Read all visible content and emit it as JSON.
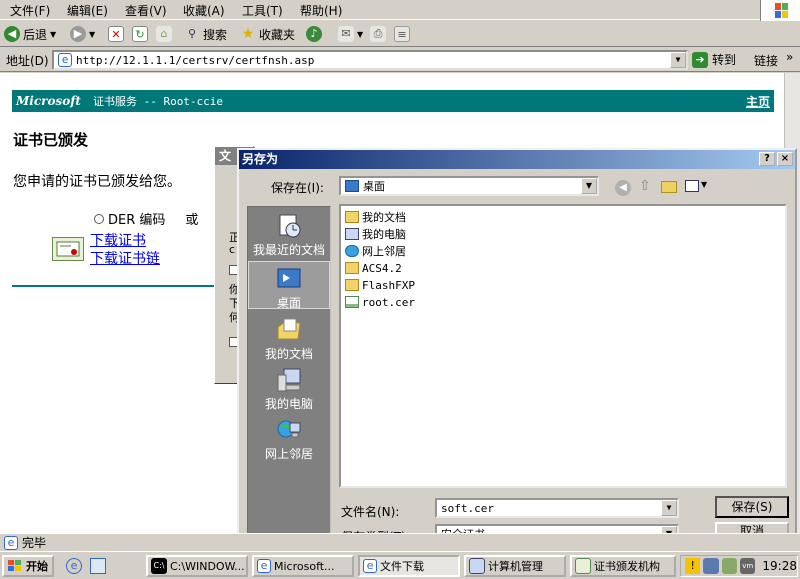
{
  "ie": {
    "menu": [
      "文件(F)",
      "编辑(E)",
      "查看(V)",
      "收藏(A)",
      "工具(T)",
      "帮助(H)"
    ],
    "toolbar": {
      "back": "后退",
      "search": "搜索",
      "favorites": "收藏夹"
    },
    "address_label": "地址(D)",
    "address": "http://12.1.1.1/certsrv/certfnsh.asp",
    "go": "转到",
    "links": "链接",
    "status": "完毕"
  },
  "page": {
    "banner_brand": "Microsoft",
    "banner_title": "证书服务 --  Root-ccie",
    "banner_home": "主页",
    "heading": "证书已颁发",
    "message": "您申请的证书已颁发给您。",
    "radio_der": "DER 编码",
    "radio_or": "或",
    "link_download_cert": "下载证书",
    "link_download_chain": "下载证书链"
  },
  "bgdialog": {
    "title": "文",
    "frag1": "正",
    "frag2": "c",
    "frag3": "你",
    "frag4": "下",
    "frag5": "何"
  },
  "saveas": {
    "title": "另存为",
    "help": "?",
    "close": "×",
    "save_in_label": "保存在(I):",
    "save_in_value": "桌面",
    "places": [
      {
        "label": "我最近的文档",
        "icon": "recent-docs-icon"
      },
      {
        "label": "桌面",
        "icon": "desktop-icon"
      },
      {
        "label": "我的文档",
        "icon": "my-documents-icon"
      },
      {
        "label": "我的电脑",
        "icon": "my-computer-icon"
      },
      {
        "label": "网上邻居",
        "icon": "network-places-icon"
      }
    ],
    "files": [
      {
        "name": "我的文档",
        "icon": "folder-icon"
      },
      {
        "name": "我的电脑",
        "icon": "computer-icon"
      },
      {
        "name": "网上邻居",
        "icon": "network-icon"
      },
      {
        "name": "ACS4.2",
        "icon": "folder-icon"
      },
      {
        "name": "FlashFXP",
        "icon": "folder-icon"
      },
      {
        "name": "root.cer",
        "icon": "certificate-file-icon"
      }
    ],
    "filename_label": "文件名(N):",
    "filename_value": "soft.cer",
    "filetype_label": "保存类型(T):",
    "filetype_value": "安全证书",
    "save_button": "保存(S)",
    "cancel_button": "取消"
  },
  "taskbar": {
    "start": "开始",
    "tasks": [
      "C:\\WINDOW...",
      "Microsoft...",
      "文件下载",
      "计算机管理",
      "证书颁发机构"
    ],
    "clock": "19:28"
  }
}
